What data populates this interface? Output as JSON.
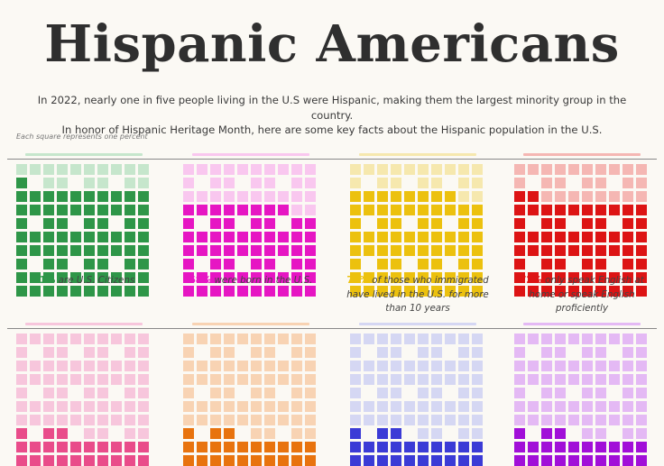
{
  "title": "Hispanic Americans",
  "subtitle_line1": "In 2022, nearly one in five people living in the U.S were Hispanic, making them the largest minority group in the country.",
  "subtitle_line2": "In honor of Hispanic Heritage Month, here are some key facts about the Hispanic population in the U.S.",
  "note": "Each square represents one percent",
  "chart_data": [
    {
      "type": "waffle",
      "value": 81,
      "total": 100,
      "pct_label": "81%",
      "caption": " are U.S. Citizens",
      "color": "#2e9648",
      "light_color": "#c6e6cc"
    },
    {
      "type": "waffle",
      "value": 68,
      "total": 100,
      "pct_label": "68%",
      "caption": " were born in the U.S.",
      "color": "#e616c3",
      "light_color": "#f9c7ef"
    },
    {
      "type": "waffle",
      "value": 78,
      "total": 100,
      "pct_label": "78%",
      "caption": " of those who immigrated have lived in the U.S. for more than 10 years",
      "color": "#ecc10e",
      "light_color": "#f6e8ae"
    },
    {
      "type": "waffle",
      "value": 72,
      "total": 100,
      "pct_label": "72%",
      "caption": " only speak English at home or speak English proficiently",
      "color": "#dd1414",
      "light_color": "#f5b7b3"
    },
    {
      "type": "waffle",
      "value": null,
      "total": 100,
      "color": "#e94c8a",
      "light_color": "#f7c6dc"
    },
    {
      "type": "waffle",
      "value": null,
      "total": 100,
      "color": "#e8730e",
      "light_color": "#f8d3b3"
    },
    {
      "type": "waffle",
      "value": null,
      "total": 100,
      "color": "#3b3bd6",
      "light_color": "#d5d7f3"
    },
    {
      "type": "waffle",
      "value": null,
      "total": 100,
      "color": "#a10fd8",
      "light_color": "#e4b9f4"
    }
  ]
}
